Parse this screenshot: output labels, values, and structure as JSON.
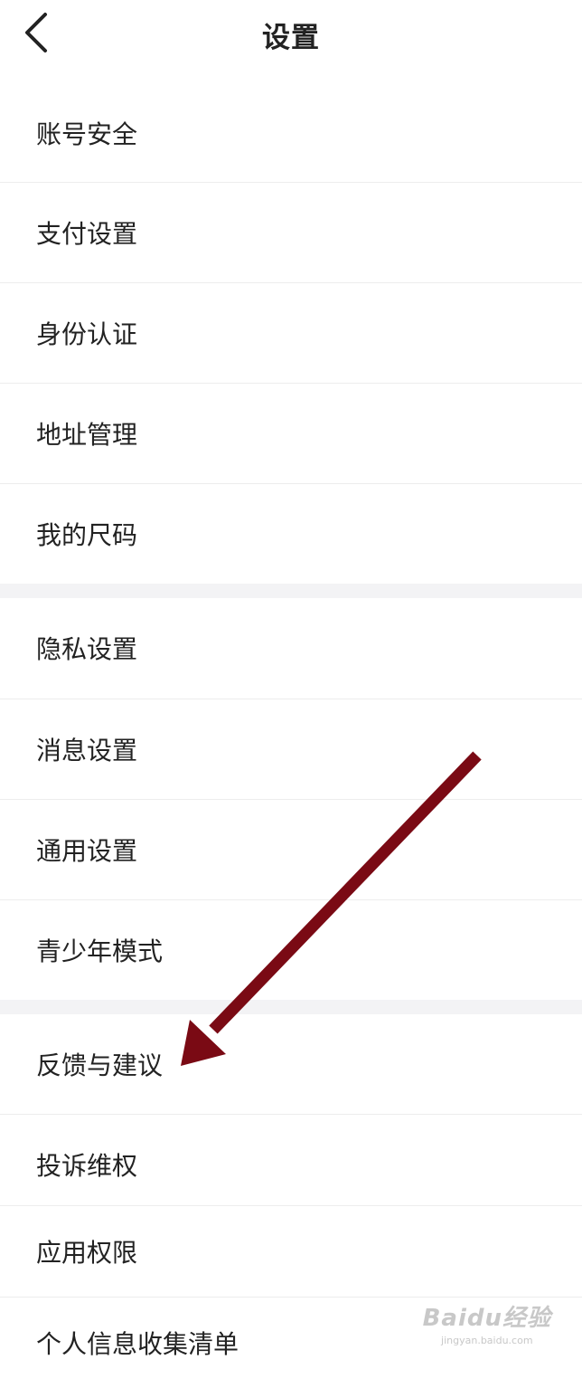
{
  "header": {
    "title": "设置",
    "back_icon": "chevron-left-icon"
  },
  "sections": [
    {
      "items": [
        {
          "label": "账号安全"
        },
        {
          "label": "支付设置"
        },
        {
          "label": "身份认证"
        },
        {
          "label": "地址管理"
        },
        {
          "label": "我的尺码"
        }
      ]
    },
    {
      "items": [
        {
          "label": "隐私设置"
        },
        {
          "label": "消息设置"
        },
        {
          "label": "通用设置"
        },
        {
          "label": "青少年模式"
        }
      ]
    },
    {
      "items": [
        {
          "label": "反馈与建议"
        },
        {
          "label": "投诉维权"
        },
        {
          "label": "应用权限"
        },
        {
          "label": "个人信息收集清单"
        }
      ]
    }
  ],
  "annotation": {
    "arrow_color": "#7a0a14",
    "points_to": "反馈与建议"
  },
  "watermark": {
    "main": "Baidu经验",
    "sub": "jingyan.baidu.com"
  },
  "colors": {
    "background": "#ffffff",
    "section_gap": "#f3f3f5",
    "divider": "#ededed",
    "text": "#222222"
  }
}
